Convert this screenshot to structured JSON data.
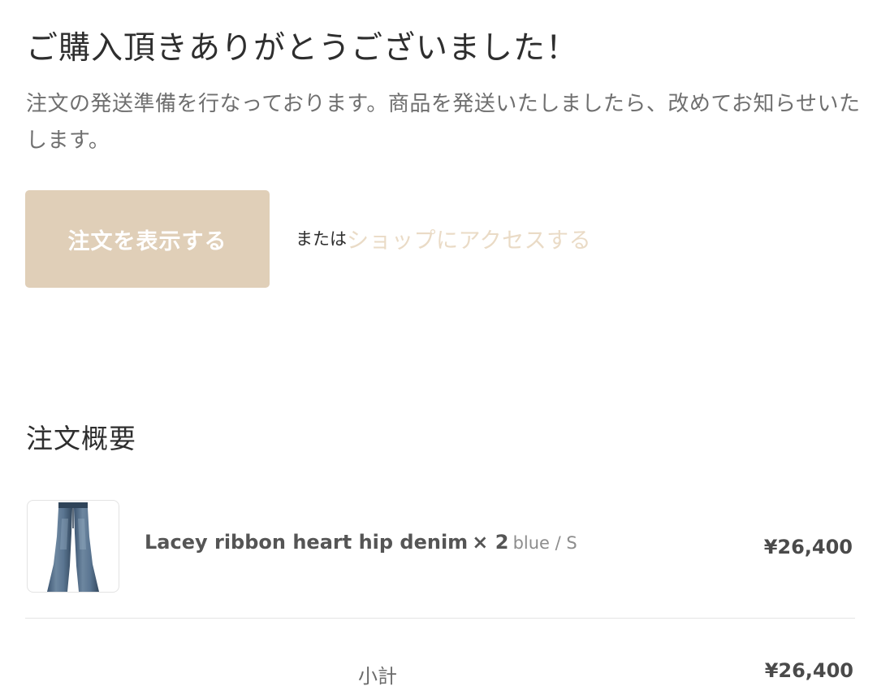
{
  "confirmation": {
    "title": "ご購入頂きありがとうございました！",
    "message": "注文の発送準備を行なっております。商品を発送いたしましたら、改めてお知らせいたします。"
  },
  "actions": {
    "view_order_label": "注文を表示する",
    "or_text": "または",
    "shop_link_label": "ショップにアクセスする"
  },
  "summary": {
    "heading": "注文概要",
    "items": [
      {
        "name": "Lacey ribbon heart hip denim",
        "quantity": "× 2",
        "variant": "blue / S",
        "price": "¥26,400",
        "thumbnail_icon": "denim-jeans-icon"
      }
    ],
    "subtotal_label": "小計",
    "subtotal_value": "¥26,400"
  },
  "colors": {
    "button_bg": "#e0cfb8",
    "link": "#eadbc6",
    "text_dark": "#2e2e2e",
    "text_muted": "#6f6f6f"
  }
}
